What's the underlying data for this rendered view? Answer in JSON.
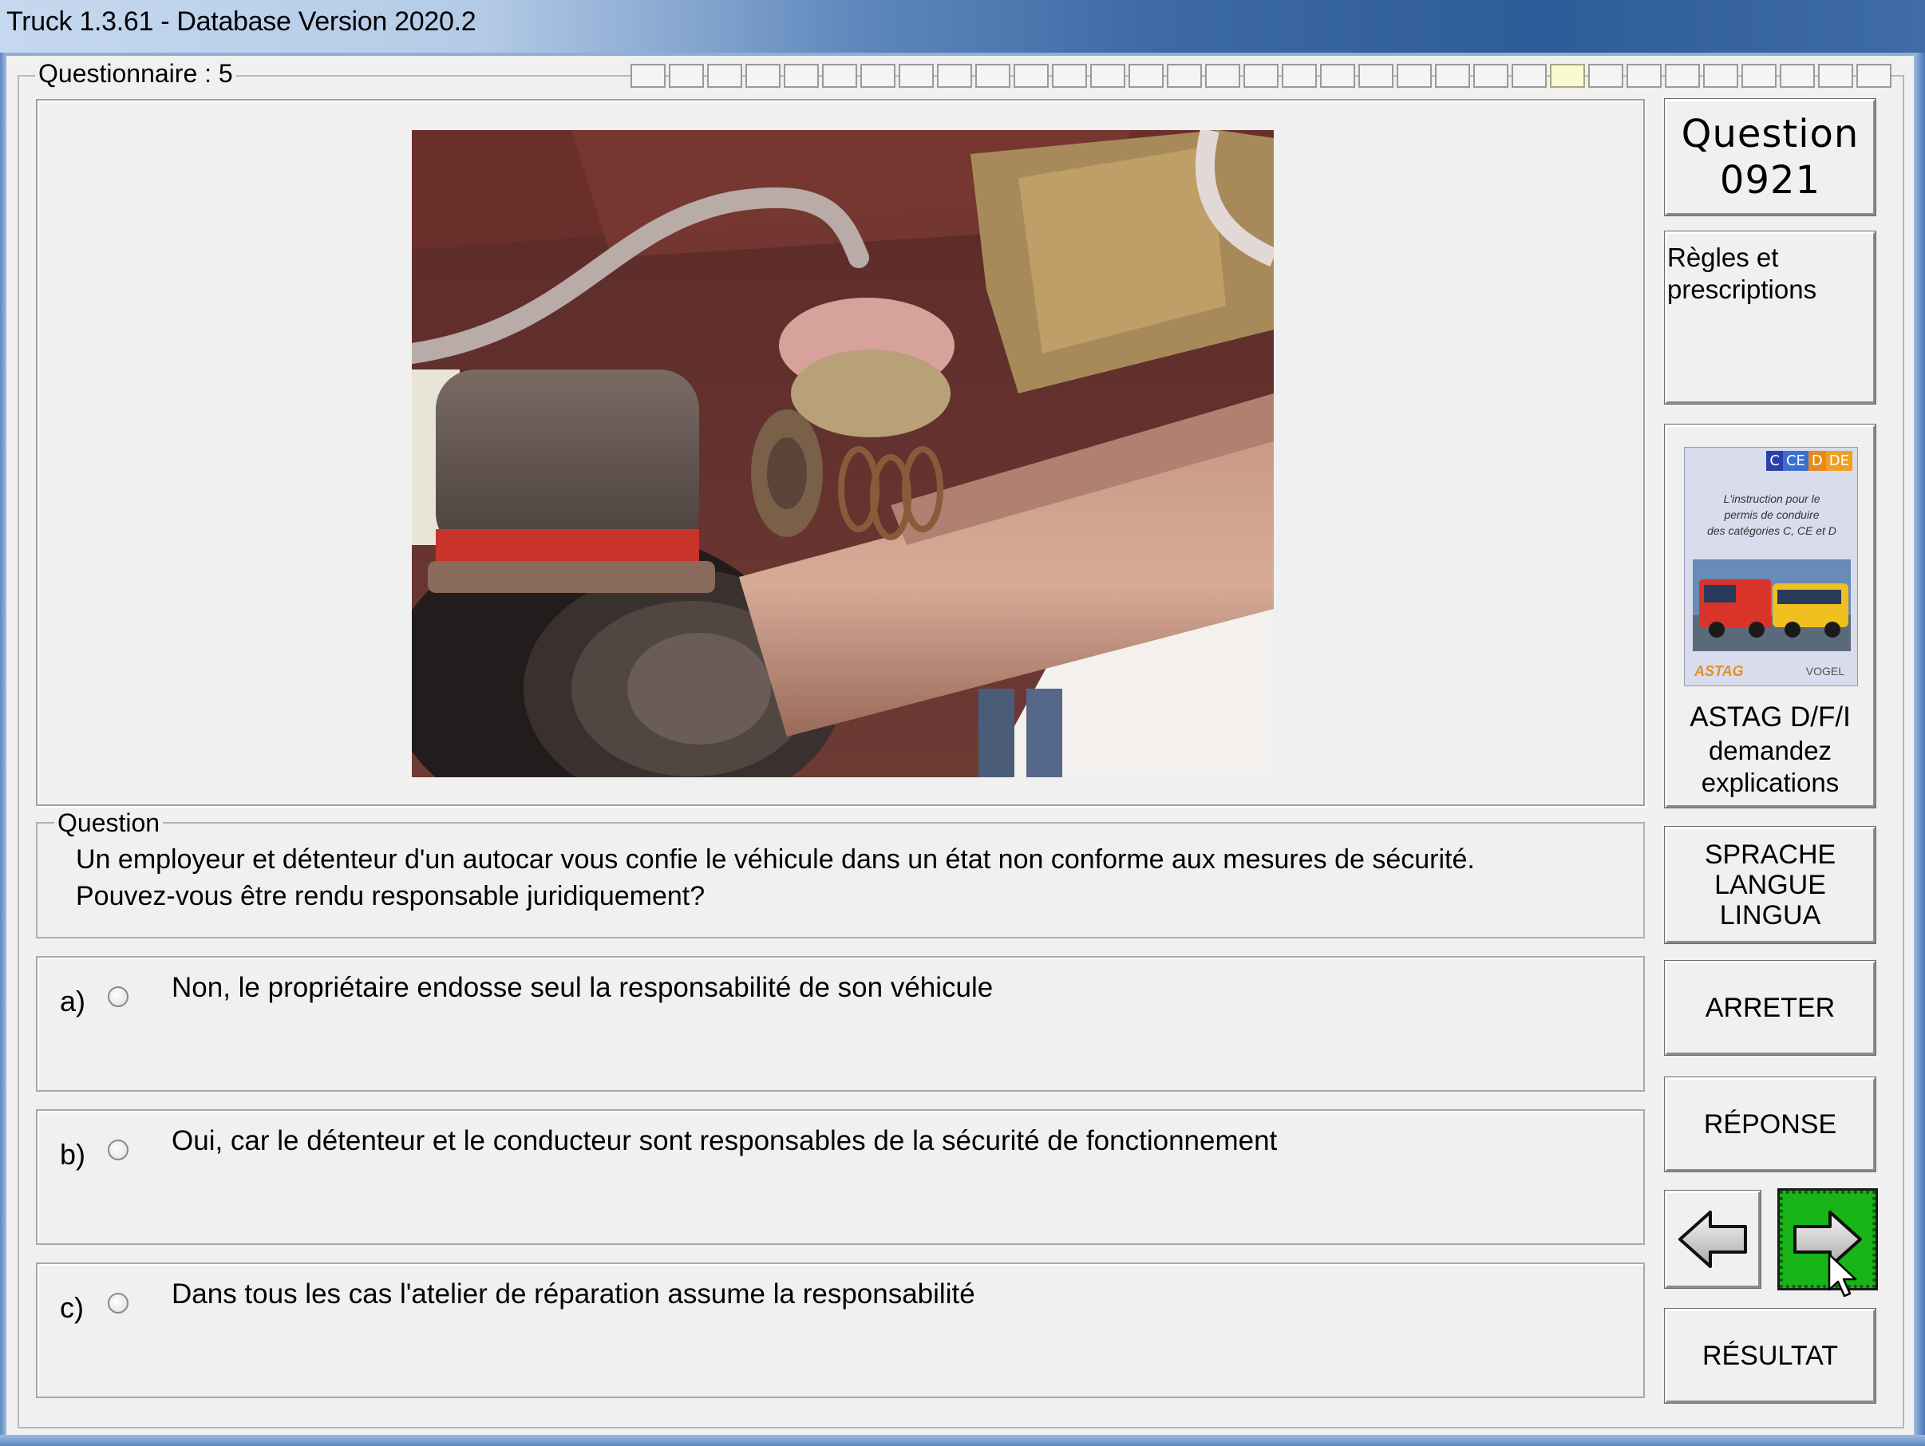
{
  "window": {
    "title": "Truck 1.3.61 - Database Version 2020.2"
  },
  "questionnaire": {
    "label": "Questionnaire : 5",
    "progress_total": 33,
    "progress_current": 25
  },
  "question_panel": {
    "legend": "Question",
    "text_line1": "Un employeur et détenteur d'un autocar vous confie le véhicule dans un état non conforme aux mesures de sécurité.",
    "text_line2": "Pouvez-vous être rendu responsable juridiquement?"
  },
  "answers": [
    {
      "letter": "a)",
      "text": "Non, le propriétaire endosse seul la responsabilité de son véhicule"
    },
    {
      "letter": "b)",
      "text": "Oui, car le détenteur et le conducteur sont responsables de la sécurité de fonctionnement"
    },
    {
      "letter": "c)",
      "text": "Dans tous les cas l'atelier de réparation assume la responsabilité"
    }
  ],
  "sidebar": {
    "question_label": "Question",
    "question_number": "0921",
    "rules_line1": "Règles et",
    "rules_line2": "prescriptions",
    "book": {
      "tags": [
        "C",
        "CE",
        "D",
        "DE"
      ],
      "tag_colors": [
        "#2a3fa8",
        "#3a6fd0",
        "#e58a1a",
        "#f0a020"
      ],
      "subtitle_line1": "L'instruction pour le",
      "subtitle_line2": "permis de conduire",
      "subtitle_line3": "des catégories C, CE et D",
      "logo_left": "ASTAG",
      "logo_right": "VOGEL"
    },
    "astag_line1": "ASTAG D/F/I",
    "astag_line2": "demandez",
    "astag_line3": "explications",
    "language_line1": "SPRACHE",
    "language_line2": "LANGUE",
    "language_line3": "LINGUA",
    "stop_label": "ARRETER",
    "answer_label": "RÉPONSE",
    "result_label": "RÉSULTAT"
  },
  "colors": {
    "next_button": "#18b418",
    "window_bg": "#f0f0f0"
  }
}
